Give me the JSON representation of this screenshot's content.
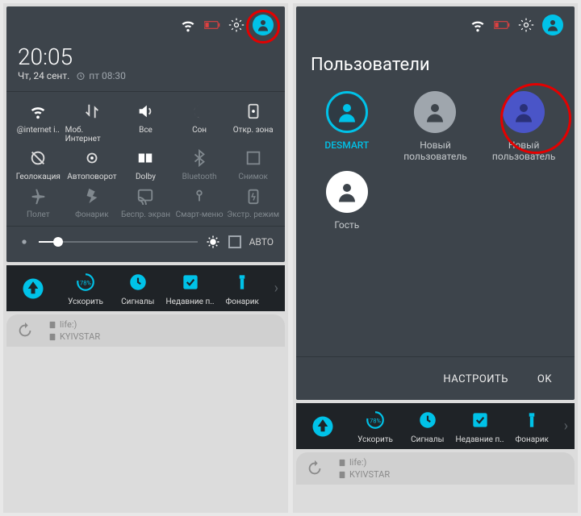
{
  "left": {
    "clock": "20:05",
    "date": "Чт, 24 сент.",
    "alarm": "пт 08:30",
    "toggles": [
      {
        "label": "@internet i..",
        "icon": "wifi"
      },
      {
        "label": "Моб. Интернет",
        "icon": "data"
      },
      {
        "label": "Все",
        "icon": "volume"
      },
      {
        "label": "Сон",
        "icon": "moon",
        "dim": false
      },
      {
        "label": "Откр. зона",
        "icon": "hotspot"
      },
      {
        "label": "Геолокация",
        "icon": "location"
      },
      {
        "label": "Автоповорот",
        "icon": "rotate"
      },
      {
        "label": "Dolby",
        "icon": "dolby"
      },
      {
        "label": "Bluetooth",
        "icon": "bt",
        "dim": true
      },
      {
        "label": "Снимок",
        "icon": "screenshot",
        "dim": true
      },
      {
        "label": "Полет",
        "icon": "plane",
        "dim": true
      },
      {
        "label": "Фонарик",
        "icon": "flash",
        "dim": true
      },
      {
        "label": "Беспр. экран",
        "icon": "cast",
        "dim": true
      },
      {
        "label": "Смарт-меню",
        "icon": "touch",
        "dim": true
      },
      {
        "label": "Экстр. режим",
        "icon": "battery",
        "dim": true
      }
    ],
    "brightness_auto": "АВТО"
  },
  "right": {
    "title": "Пользователи",
    "users": [
      {
        "name": "DESMART",
        "style": "active"
      },
      {
        "name": "Новый\nпользователь",
        "style": "gray"
      },
      {
        "name": "Новый\nпользователь",
        "style": "blue"
      },
      {
        "name": "Гость",
        "style": "white"
      }
    ],
    "action_settings": "НАСТРОИТЬ",
    "action_ok": "OK"
  },
  "shortcuts": [
    {
      "label": "Ускорить",
      "icon": "boost"
    },
    {
      "label": "Сигналы",
      "icon": "clock78"
    },
    {
      "label": "Недавние п..",
      "icon": "recent"
    },
    {
      "label": "Фонарик",
      "icon": "torch"
    }
  ],
  "sim": {
    "slot1": "life:)",
    "slot2": "KYIVSTAR"
  }
}
